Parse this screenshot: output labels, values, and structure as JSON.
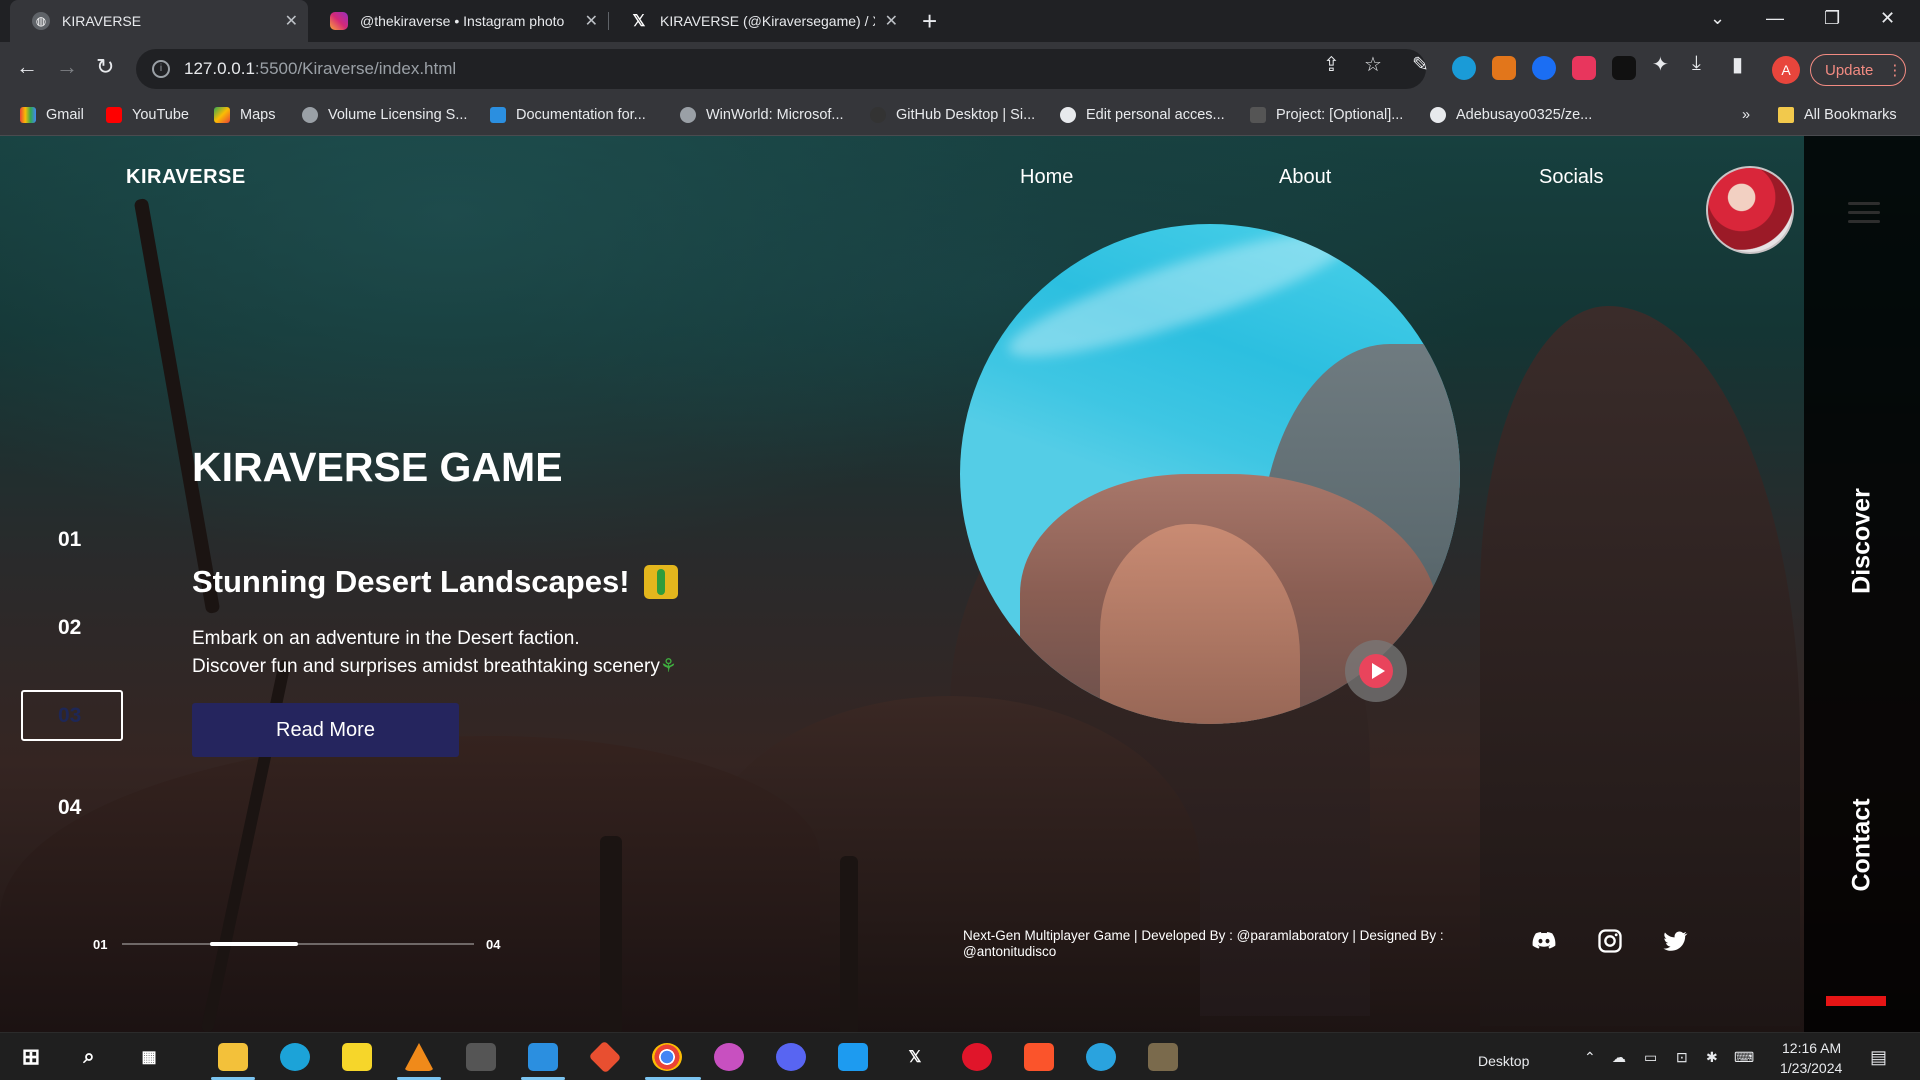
{
  "browser": {
    "tabs": [
      {
        "title": "KIRAVERSE",
        "active": true
      },
      {
        "title": "@thekiraverse • Instagram photo",
        "active": false
      },
      {
        "title": "KIRAVERSE (@Kiraversegame) / X",
        "active": false
      }
    ],
    "url_host": "127.0.0.1",
    "url_path": ":5500/Kiraverse/index.html",
    "profile_initial": "A",
    "update_label": "Update",
    "bookmarks": [
      "Gmail",
      "YouTube",
      "Maps",
      "Volume Licensing S...",
      "Documentation for...",
      "WinWorld: Microsof...",
      "GitHub Desktop | Si...",
      "Edit personal acces...",
      "Project: [Optional]...",
      "Adebusayo0325/ze..."
    ],
    "bookmarks_overflow": "»",
    "all_bookmarks": "All Bookmarks"
  },
  "site": {
    "brand": "KIRAVERSE",
    "nav": [
      "Home",
      "About",
      "Socials"
    ],
    "hero_title": "KIRAVERSE GAME",
    "slides": [
      "01",
      "02",
      "03",
      "04"
    ],
    "active_slide": "03",
    "subtitle": "Stunning Desert Landscapes!",
    "desc_line1": "Embark on an adventure in the Desert faction.",
    "desc_line2": "Discover fun and surprises amidst breathtaking scenery",
    "read_more": "Read More",
    "side_discover": "Discover",
    "side_contact": "Contact",
    "progress_start": "01",
    "progress_end": "04",
    "progress_fraction": 0.25,
    "footer": "Next-Gen Multiplayer Game | Developed By : @paramlaboratory | Designed By : @antonitudisco",
    "socials": [
      "discord-icon",
      "instagram-icon",
      "twitter-icon"
    ]
  },
  "taskbar": {
    "desktop_label": "Desktop",
    "time": "12:16 AM",
    "date": "1/23/2024"
  },
  "colors": {
    "button": "#25255e",
    "accent_red": "#e61515",
    "play": "#e9445c"
  }
}
